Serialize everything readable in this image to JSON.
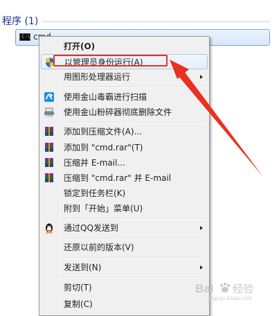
{
  "results": {
    "section_header": "程序 (1)",
    "item": {
      "label": "cmd",
      "icon": "cmd-icon"
    }
  },
  "context_menu": {
    "items": [
      {
        "label": "打开(O)",
        "bold": true
      },
      {
        "label": "以管理员身份运行(A)",
        "icon": "uac-shield-icon",
        "highlighted": true
      },
      {
        "label": "用图形处理器运行",
        "submenu": true
      },
      {
        "label": "使用金山毒霸进行扫描",
        "icon": "duba-scan-icon"
      },
      {
        "label": "使用金山粉碎器彻底删除文件",
        "icon": "shredder-icon"
      },
      {
        "label": "添加到压缩文件(A)...",
        "icon": "winrar-icon"
      },
      {
        "label": "添加到 \"cmd.rar\"(T)",
        "icon": "winrar-icon"
      },
      {
        "label": "压缩并 E-mail...",
        "icon": "winrar-icon"
      },
      {
        "label": "压缩到 \"cmd.rar\" 并 E-mail",
        "icon": "winrar-icon"
      },
      {
        "label": "锁定到任务栏(K)"
      },
      {
        "label": "附到「开始」菜单(U)"
      },
      {
        "label": "通过QQ发送到",
        "icon": "qq-penguin-icon",
        "submenu": true
      },
      {
        "label": "还原以前的版本(V)"
      },
      {
        "label": "发送到(N)",
        "submenu": true
      },
      {
        "label": "剪切(T)"
      },
      {
        "label": "复制(C)"
      }
    ]
  },
  "annotation": {
    "color": "#e8311f"
  },
  "watermark": {
    "text": "Bai经验",
    "sub": "jingyan.baidu.com"
  }
}
